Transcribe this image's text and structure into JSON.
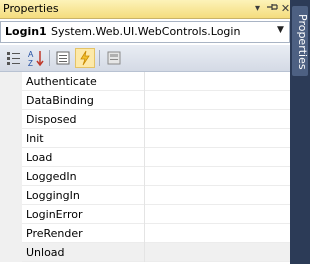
{
  "window": {
    "title": "Properties"
  },
  "selector": {
    "object_name": "Login1",
    "object_type": "System.Web.UI.WebControls.Login"
  },
  "toolbar": {
    "buttons": [
      {
        "name": "categorized-icon",
        "active": false
      },
      {
        "name": "alphabetical-icon",
        "active": false
      },
      {
        "name": "properties-icon",
        "active": false
      },
      {
        "name": "events-icon",
        "active": true
      },
      {
        "name": "property-pages-icon",
        "active": false
      }
    ]
  },
  "events": [
    {
      "name": "Authenticate",
      "value": ""
    },
    {
      "name": "DataBinding",
      "value": ""
    },
    {
      "name": "Disposed",
      "value": ""
    },
    {
      "name": "Init",
      "value": ""
    },
    {
      "name": "Load",
      "value": ""
    },
    {
      "name": "LoggedIn",
      "value": ""
    },
    {
      "name": "LoggingIn",
      "value": ""
    },
    {
      "name": "LoginError",
      "value": ""
    },
    {
      "name": "PreRender",
      "value": ""
    },
    {
      "name": "Unload",
      "value": ""
    }
  ],
  "selected_event": "Unload",
  "side_tab": {
    "label": "Properties"
  }
}
